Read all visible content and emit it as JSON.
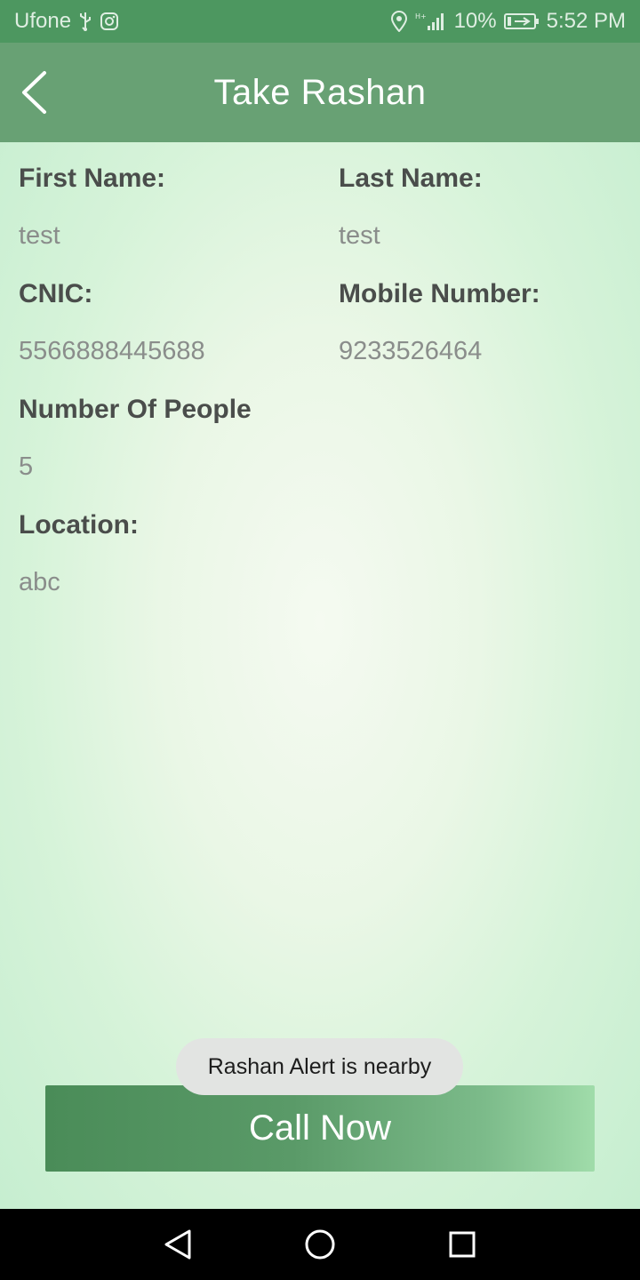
{
  "status_bar": {
    "carrier": "Ufone",
    "battery": "10%",
    "time": "5:52 PM"
  },
  "app_bar": {
    "title": "Take Rashan"
  },
  "fields": {
    "first_name": {
      "label": "First Name:",
      "value": "test"
    },
    "last_name": {
      "label": "Last Name:",
      "value": "test"
    },
    "cnic": {
      "label": "CNIC:",
      "value": "5566888445688"
    },
    "mobile": {
      "label": "Mobile Number:",
      "value": "9233526464"
    },
    "people": {
      "label": "Number Of People",
      "value": "5"
    },
    "location": {
      "label": "Location:",
      "value": "abc"
    }
  },
  "toast": {
    "text": "Rashan Alert is nearby"
  },
  "call_button": {
    "label": "Call Now"
  },
  "colors": {
    "status_bar": "#4d9760",
    "app_bar": "#68a174",
    "accent": "#4a8c58"
  }
}
